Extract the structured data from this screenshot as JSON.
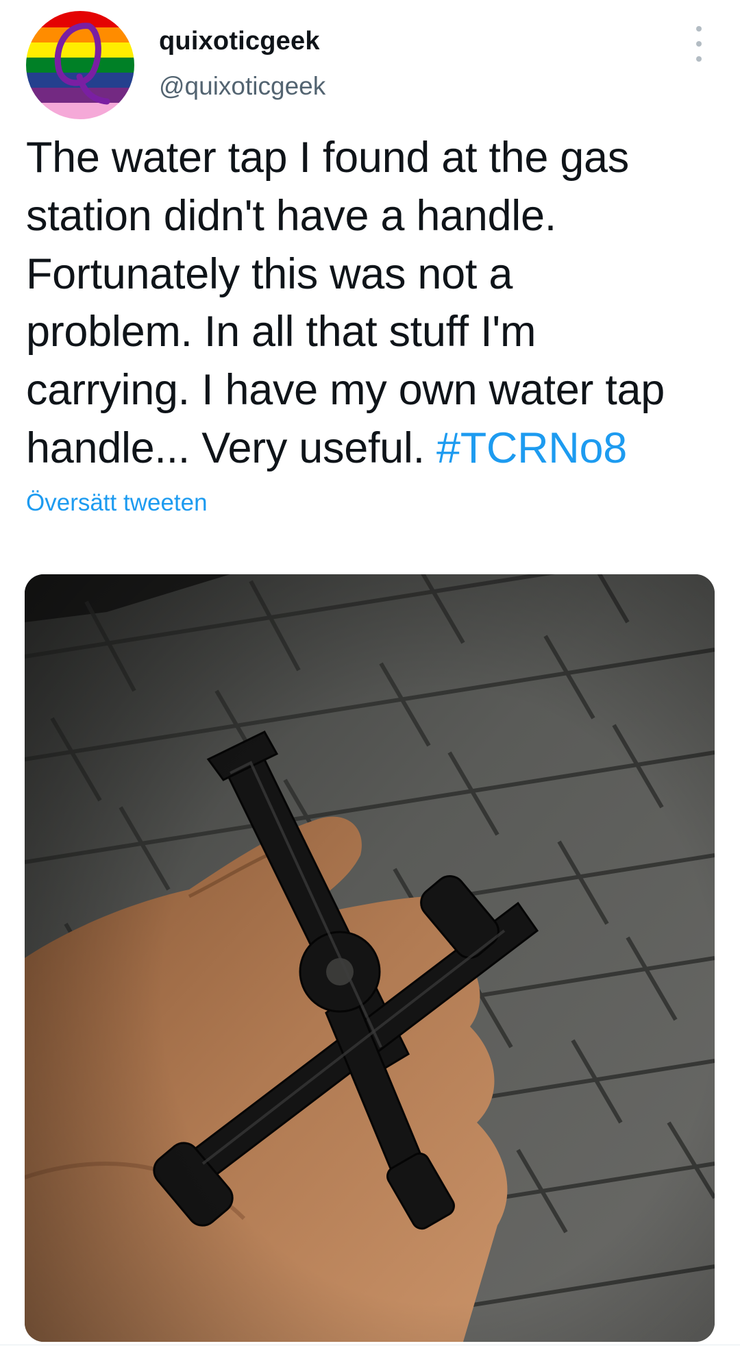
{
  "tweet": {
    "display_name": "quixoticgeek",
    "handle": "@quixoticgeek",
    "avatar_letter": "Q",
    "text_lines": [
      "The water tap I found at the gas",
      "station didn't have a handle.",
      "Fortunately this was not a",
      "problem. In all that stuff I'm",
      "carrying. I have my own water tap",
      "handle... Very useful. "
    ],
    "hashtag": "#TCRNo8",
    "translate_label": "Översätt tweeten",
    "more_icon": "more-vertical-icon",
    "media_description_icon": "photo"
  },
  "colors": {
    "link": "#1d9bf0",
    "text": "#0f1419",
    "secondary": "#536471",
    "avatar_stripes": [
      "#e40303",
      "#ff8c00",
      "#ffed00",
      "#008026",
      "#24408e",
      "#732982",
      "#f5a9d8"
    ],
    "avatar_letter": "#7a1fa2"
  }
}
